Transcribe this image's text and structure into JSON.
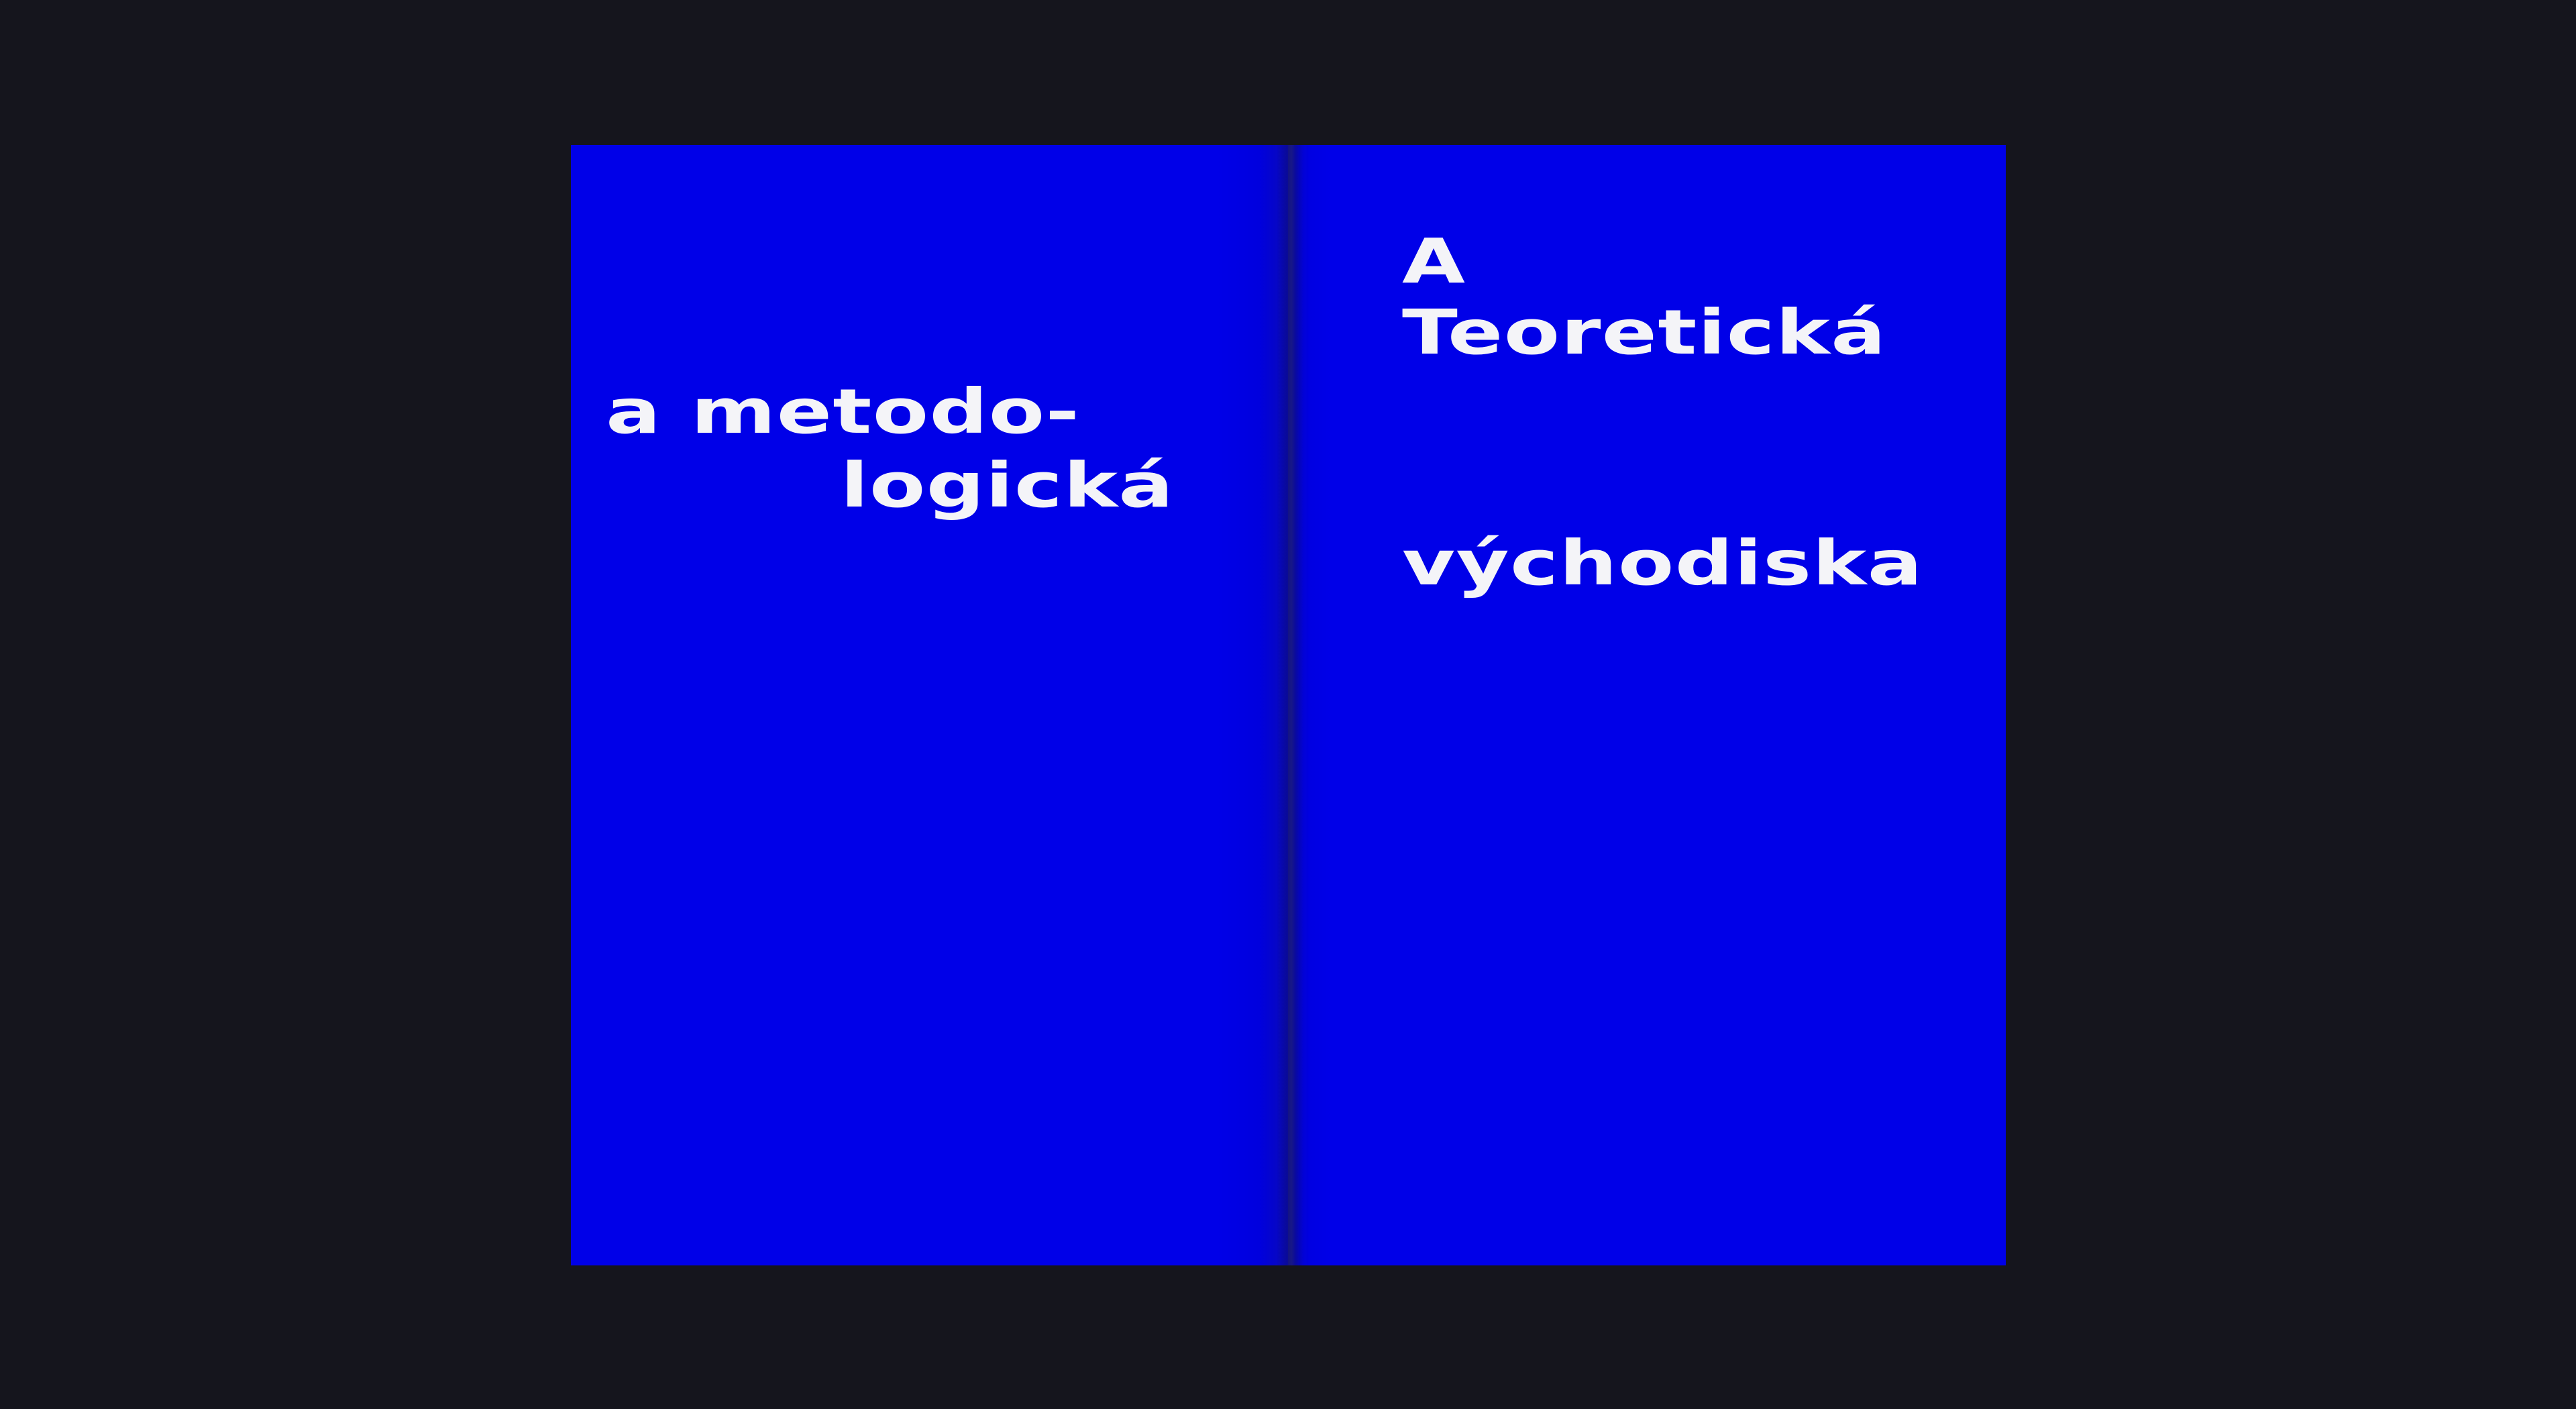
{
  "colors": {
    "background": "#15151d",
    "page": "#0000e8",
    "text": "#f4f4f8"
  },
  "left_page": {
    "line1": "a metodo-",
    "line2": "logická"
  },
  "right_page": {
    "line1": "A",
    "line2": "Teoretická",
    "line3": "východiska"
  }
}
